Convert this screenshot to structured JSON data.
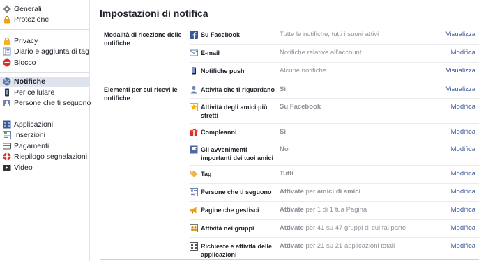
{
  "sidebar": {
    "groups": [
      [
        {
          "label": "Generali",
          "icon": "gear-icon"
        },
        {
          "label": "Protezione",
          "icon": "lock-icon"
        }
      ],
      [
        {
          "label": "Privacy",
          "icon": "privacy-lock-icon"
        },
        {
          "label": "Diario e aggiunta di tag",
          "icon": "timeline-icon"
        },
        {
          "label": "Blocco",
          "icon": "block-icon"
        }
      ],
      [
        {
          "label": "Notifiche",
          "icon": "globe-icon",
          "selected": true
        },
        {
          "label": "Per cellulare",
          "icon": "mobile-icon"
        },
        {
          "label": "Persone che ti seguono",
          "icon": "followers-icon"
        }
      ],
      [
        {
          "label": "Applicazioni",
          "icon": "apps-icon"
        },
        {
          "label": "Inserzioni",
          "icon": "ads-icon"
        },
        {
          "label": "Pagamenti",
          "icon": "payments-icon"
        },
        {
          "label": "Riepilogo segnalazioni",
          "icon": "support-icon"
        },
        {
          "label": "Video",
          "icon": "video-icon"
        }
      ]
    ]
  },
  "main": {
    "title": "Impostazioni di notifica",
    "sections": [
      {
        "label": "Modalità di ricezione delle notifiche",
        "rows": [
          {
            "icon": "facebook-icon",
            "name": "Su Facebook",
            "value": "Tutte le notifiche, tutti i suoni attivi",
            "action": "Visualizza"
          },
          {
            "icon": "email-icon",
            "name": "E-mail",
            "value": "Notifiche relative all'account",
            "action": "Modifica"
          },
          {
            "icon": "phone-icon",
            "name": "Notifiche push",
            "value": "Alcune notifiche",
            "action": "Visualizza"
          }
        ]
      },
      {
        "label": "Elementi per cui ricevi le notifiche",
        "rows": [
          {
            "icon": "person-icon",
            "name": "Attività che ti riguardano",
            "value_bold": "Sì",
            "value": "",
            "action": "Visualizza"
          },
          {
            "icon": "star-icon",
            "name": "Attività degli amici più stretti",
            "value_bold": "Su Facebook",
            "value": "",
            "action": "Modifica"
          },
          {
            "icon": "gift-icon",
            "name": "Compleanni",
            "value_bold": "Sì",
            "value": "",
            "action": "Modifica"
          },
          {
            "icon": "flag-icon",
            "name": "Gli avvenimenti importanti dei tuoi amici",
            "value_bold": "No",
            "value": "",
            "action": "Modifica"
          },
          {
            "icon": "tag-icon",
            "name": "Tag",
            "value_bold": "Tutti",
            "value": "",
            "action": "Modifica"
          },
          {
            "icon": "followers-list-icon",
            "name": "Persone che ti seguono",
            "value_bold": "Attivate",
            "value": " per ",
            "value_bold2": "amici di amici",
            "action": "Modifica"
          },
          {
            "icon": "megaphone-icon",
            "name": "Pagine che gestisci",
            "value_bold": "Attivate",
            "value": " per 1 di 1 tua Pagina",
            "action": "Modifica"
          },
          {
            "icon": "group-icon",
            "name": "Attività nei gruppi",
            "value_bold": "Attivate",
            "value": " per 41 su 47 gruppi di cui fai parte",
            "action": "Modifica"
          },
          {
            "icon": "apps-requests-icon",
            "name": "Richieste e attività delle applicazioni",
            "value_bold": "Attivate",
            "value": " per 21 su 21 applicazioni totali",
            "action": "Modifica"
          }
        ]
      }
    ]
  }
}
